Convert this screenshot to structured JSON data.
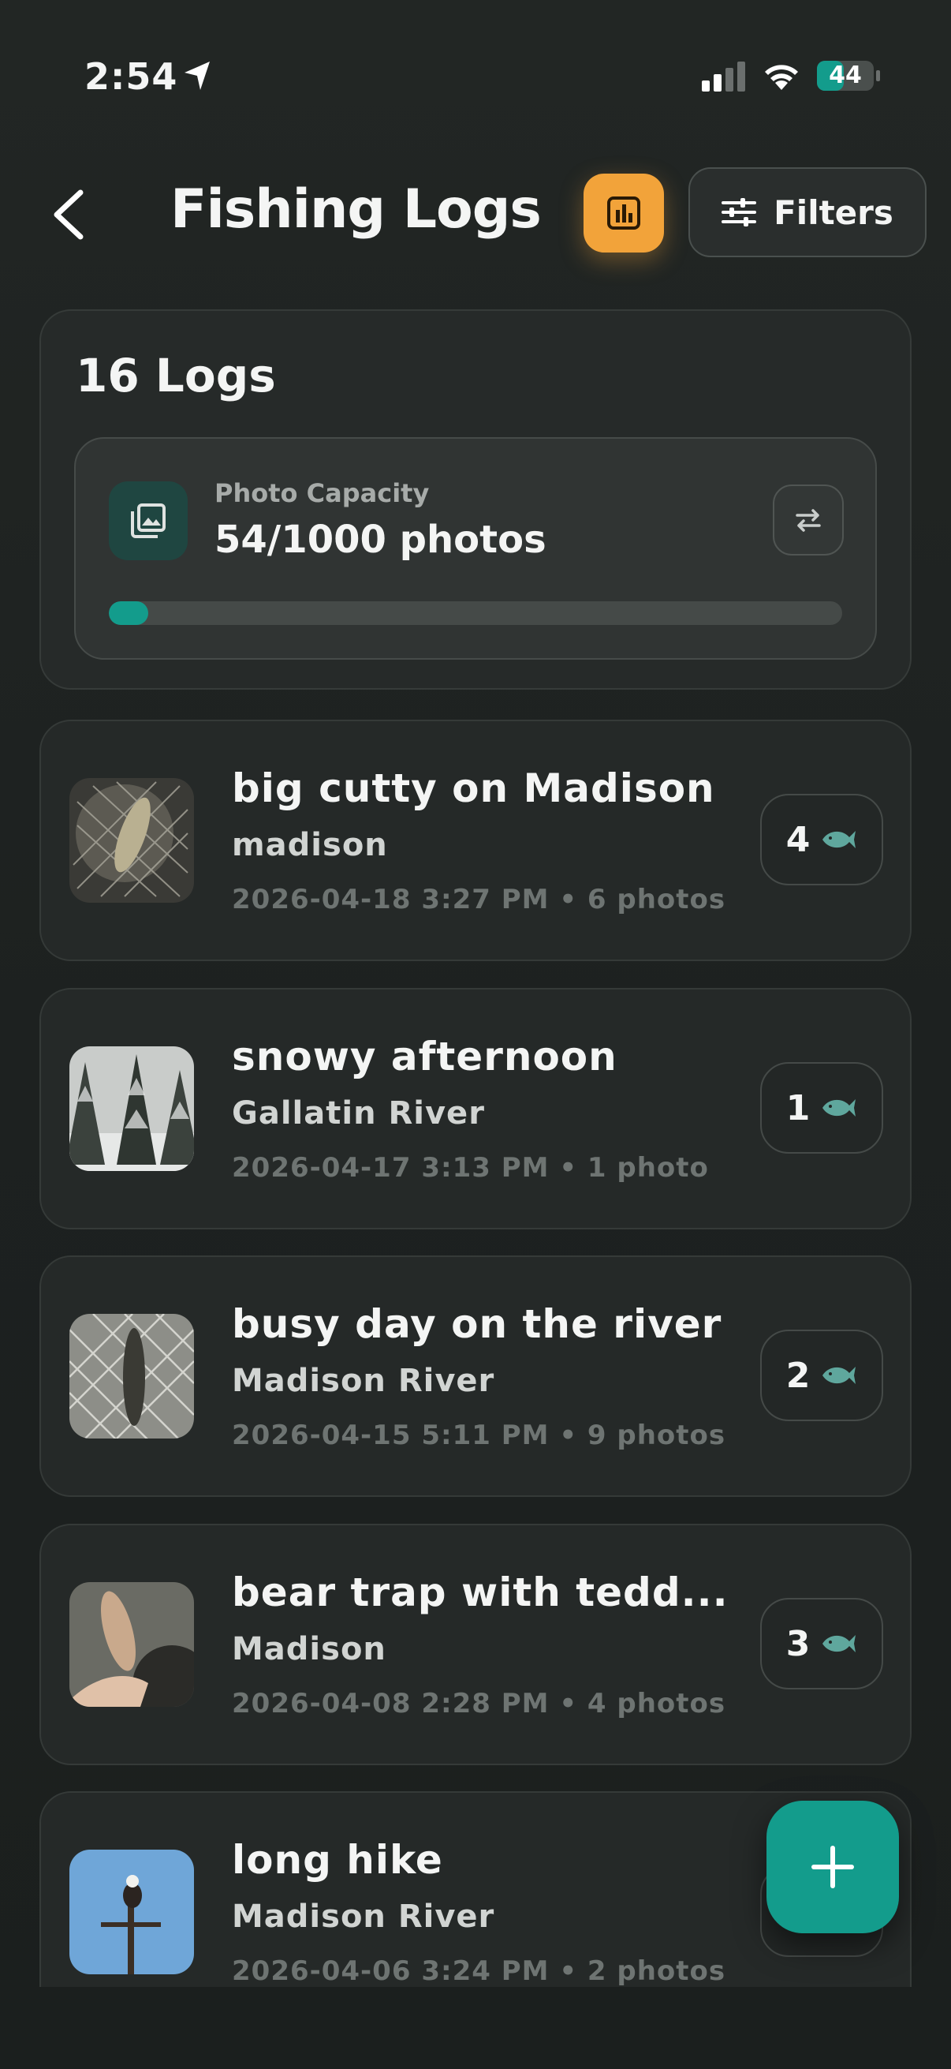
{
  "status_bar": {
    "time": "2:54",
    "battery": "44"
  },
  "header": {
    "title": "Fishing Logs",
    "filters_label": "Filters"
  },
  "summary": {
    "logs_count": "16 Logs",
    "capacity_label": "Photo Capacity",
    "capacity_value": "54/1000 photos",
    "capacity_fraction": 0.054
  },
  "logs": [
    {
      "title": "big cutty on Madison",
      "location": "madison",
      "meta": "2026-04-18 3:27 PM • 6 photos",
      "count": "4",
      "thumb": "fish-net-photo"
    },
    {
      "title": "snowy afternoon",
      "location": "Gallatin River",
      "meta": "2026-04-17 3:13 PM • 1 photo",
      "count": "1",
      "thumb": "snowy-trees-photo"
    },
    {
      "title": "busy day on the river",
      "location": "Madison River",
      "meta": "2026-04-15 5:11 PM • 9 photos",
      "count": "2",
      "thumb": "fish-net-photo"
    },
    {
      "title": "bear trap with tedd...",
      "location": "Madison",
      "meta": "2026-04-08 2:28 PM • 4 photos",
      "count": "3",
      "thumb": "fish-in-hand-photo"
    },
    {
      "title": "long hike",
      "location": "Madison River",
      "meta": "2026-04-06 3:24 PM • 2 photos",
      "count": "",
      "thumb": "eagle-on-pole-photo"
    }
  ],
  "colors": {
    "accent": "#139c8c",
    "stats_button": "#f2a33a",
    "background": "#1c201f"
  }
}
